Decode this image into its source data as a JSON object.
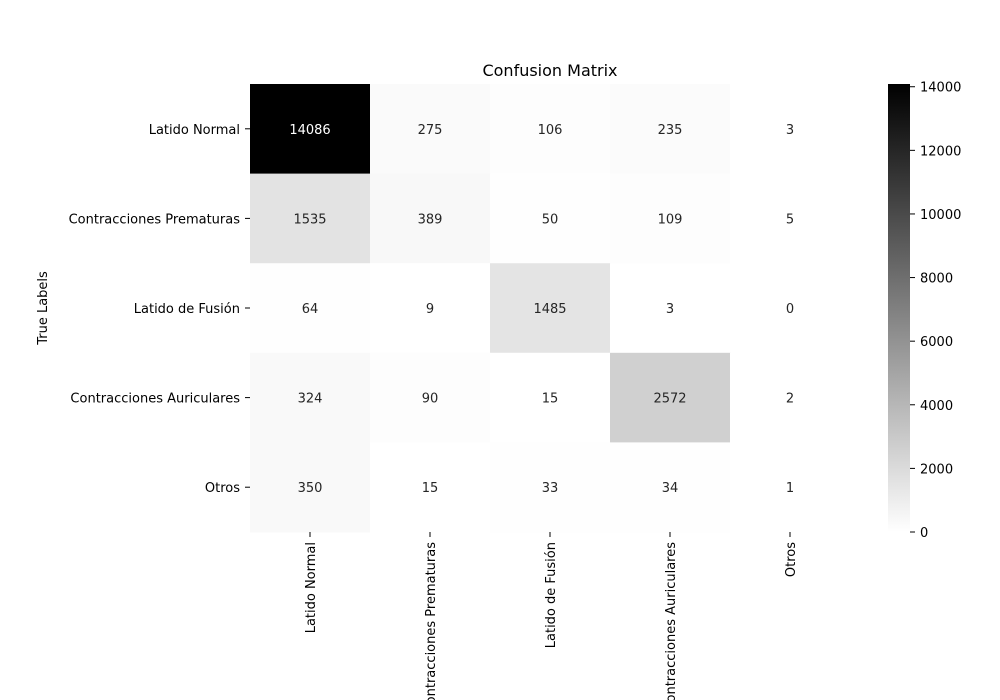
{
  "chart_data": {
    "type": "heatmap",
    "title": "Confusion Matrix",
    "ylabel": "True Labels",
    "xlabel": "",
    "row_labels": [
      "Latido Normal",
      "Contracciones Prematuras",
      "Latido de Fusión",
      "Contracciones Auriculares",
      "Otros"
    ],
    "col_labels": [
      "Latido Normal",
      "Contracciones Prematuras",
      "Latido de Fusión",
      "Contracciones Auriculares",
      "Otros"
    ],
    "values": [
      [
        14086,
        275,
        106,
        235,
        3
      ],
      [
        1535,
        389,
        50,
        109,
        5
      ],
      [
        64,
        9,
        1485,
        3,
        0
      ],
      [
        324,
        90,
        15,
        2572,
        2
      ],
      [
        350,
        15,
        33,
        34,
        1
      ]
    ],
    "colormap": "Greys",
    "value_range": [
      0,
      14086
    ],
    "colorbar_ticks": [
      0,
      2000,
      4000,
      6000,
      8000,
      10000,
      12000,
      14000
    ],
    "legend_placement": "right",
    "grid": false
  }
}
